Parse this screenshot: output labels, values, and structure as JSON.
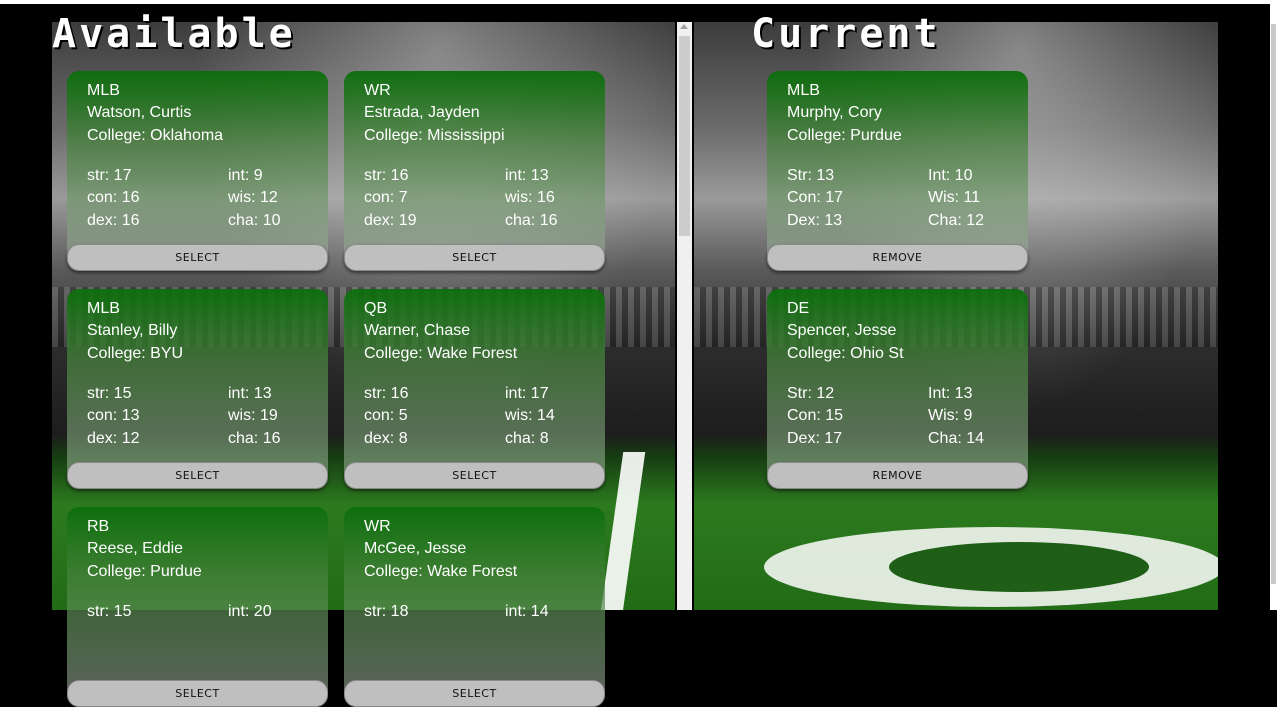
{
  "available": {
    "heading": "Available",
    "cards": [
      {
        "pos": "MLB",
        "name": "Watson, Curtis",
        "college": "College: Oklahoma",
        "stats": [
          "str: 17",
          "int: 9",
          "con: 16",
          "wis: 12",
          "dex: 16",
          "cha: 10"
        ],
        "action": "SELECT"
      },
      {
        "pos": "WR",
        "name": "Estrada, Jayden",
        "college": "College: Mississippi",
        "stats": [
          "str: 16",
          "int: 13",
          "con: 7",
          "wis: 16",
          "dex: 19",
          "cha: 16"
        ],
        "action": "SELECT"
      },
      {
        "pos": "MLB",
        "name": "Stanley, Billy",
        "college": "College: BYU",
        "stats": [
          "str: 15",
          "int: 13",
          "con: 13",
          "wis: 19",
          "dex: 12",
          "cha: 16"
        ],
        "action": "SELECT"
      },
      {
        "pos": "QB",
        "name": "Warner, Chase",
        "college": "College: Wake Forest",
        "stats": [
          "str: 16",
          "int: 17",
          "con: 5",
          "wis: 14",
          "dex: 8",
          "cha: 8"
        ],
        "action": "SELECT"
      },
      {
        "pos": "RB",
        "name": "Reese, Eddie",
        "college": "College: Purdue",
        "stats": [
          "str: 15",
          "int: 20",
          "",
          "",
          "",
          ""
        ],
        "action": "SELECT"
      },
      {
        "pos": "WR",
        "name": "McGee, Jesse",
        "college": "College: Wake Forest",
        "stats": [
          "str: 18",
          "int: 14",
          "",
          "",
          "",
          ""
        ],
        "action": "SELECT"
      }
    ]
  },
  "current": {
    "heading": "Current",
    "cards": [
      {
        "pos": "MLB",
        "name": "Murphy, Cory",
        "college": "College: Purdue",
        "stats": [
          "Str: 13",
          "Int: 10",
          "Con: 17",
          "Wis: 11",
          "Dex: 13",
          "Cha: 12"
        ],
        "action": "REMOVE"
      },
      {
        "pos": "DE",
        "name": "Spencer, Jesse",
        "college": "College: Ohio St",
        "stats": [
          "Str: 12",
          "Int: 13",
          "Con: 15",
          "Wis: 9",
          "Dex: 17",
          "Cha: 14"
        ],
        "action": "REMOVE"
      }
    ]
  },
  "colors": {
    "card_green": "#0c6e0c",
    "button_gray": "#bfbfbf",
    "field_green": "#2c7a1e"
  }
}
